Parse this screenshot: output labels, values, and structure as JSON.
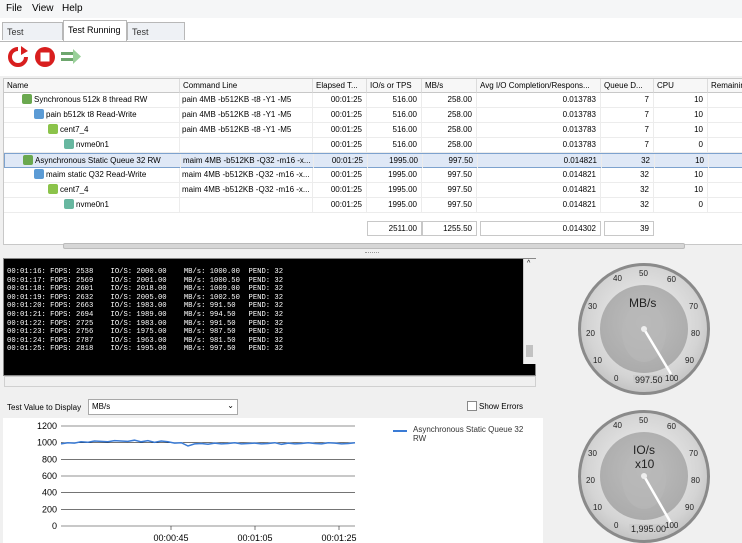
{
  "menu": {
    "file": "File",
    "view": "View",
    "help": "Help"
  },
  "tabs": [
    {
      "label": "Test Planning"
    },
    {
      "label": "Test Running"
    },
    {
      "label": "Test Analysis"
    }
  ],
  "grid": {
    "headers": [
      "Name",
      "Command Line",
      "Elapsed T...",
      "IO/s or TPS",
      "MB/s",
      "Avg I/O Completion/Respons...",
      "Queue D...",
      "CPU",
      "Remainin"
    ],
    "rows": [
      {
        "name": "Synchronous 512k 8 thread RW",
        "cmd": "pain 4MB -b512KB -t8 -Y1 -M5",
        "elapsed": "00:01:25",
        "io": "516.00",
        "mbs": "258.00",
        "avg": "0.013783",
        "queue": "7",
        "cpu": "10"
      },
      {
        "name": "pain b512k t8 Read-Write",
        "cmd": "pain 4MB -b512KB -t8 -Y1 -M5",
        "elapsed": "00:01:25",
        "io": "516.00",
        "mbs": "258.00",
        "avg": "0.013783",
        "queue": "7",
        "cpu": "10"
      },
      {
        "name": "cent7_4",
        "cmd": "pain 4MB -b512KB -t8 -Y1 -M5",
        "elapsed": "00:01:25",
        "io": "516.00",
        "mbs": "258.00",
        "avg": "0.013783",
        "queue": "7",
        "cpu": "10"
      },
      {
        "name": "nvme0n1",
        "cmd": "",
        "elapsed": "00:01:25",
        "io": "516.00",
        "mbs": "258.00",
        "avg": "0.013783",
        "queue": "7",
        "cpu": "0"
      },
      {
        "name": "Asynchronous Static Queue 32 RW",
        "cmd": "maim 4MB -b512KB -Q32 -m16 -x...",
        "elapsed": "00:01:25",
        "io": "1995.00",
        "mbs": "997.50",
        "avg": "0.014821",
        "queue": "32",
        "cpu": "10"
      },
      {
        "name": "maim static Q32 Read-Write",
        "cmd": "maim 4MB -b512KB -Q32 -m16 -x...",
        "elapsed": "00:01:25",
        "io": "1995.00",
        "mbs": "997.50",
        "avg": "0.014821",
        "queue": "32",
        "cpu": "10"
      },
      {
        "name": "cent7_4",
        "cmd": "maim 4MB -b512KB -Q32 -m16 -x...",
        "elapsed": "00:01:25",
        "io": "1995.00",
        "mbs": "997.50",
        "avg": "0.014821",
        "queue": "32",
        "cpu": "10"
      },
      {
        "name": "nvme0n1",
        "cmd": "",
        "elapsed": "00:01:25",
        "io": "1995.00",
        "mbs": "997.50",
        "avg": "0.014821",
        "queue": "32",
        "cpu": "0"
      }
    ],
    "totals": {
      "io": "2511.00",
      "mbs": "1255.50",
      "avg": "0.014302",
      "queue": "39"
    }
  },
  "console_lines": [
    "00:01:16: FOPS: 2538    IO/S: 2000.00    MB/s: 1000.00  PEND: 32",
    "00:01:17: FOPS: 2569    IO/S: 2001.00    MB/s: 1000.50  PEND: 32",
    "00:01:18: FOPS: 2601    IO/S: 2018.00    MB/s: 1009.00  PEND: 32",
    "00:01:19: FOPS: 2632    IO/S: 2005.00    MB/s: 1002.50  PEND: 32",
    "00:01:20: FOPS: 2663    IO/S: 1983.00    MB/s: 991.50   PEND: 32",
    "00:01:21: FOPS: 2694    IO/S: 1989.00    MB/s: 994.50   PEND: 32",
    "00:01:22: FOPS: 2725    IO/S: 1983.00    MB/s: 991.50   PEND: 32",
    "00:01:23: FOPS: 2756    IO/S: 1975.00    MB/s: 987.50   PEND: 32",
    "00:01:24: FOPS: 2787    IO/S: 1963.00    MB/s: 981.50   PEND: 32",
    "00:01:25: FOPS: 2818    IO/S: 1995.00    MB/s: 997.50   PEND: 32"
  ],
  "controls": {
    "display_label": "Test Value to Display",
    "display_value": "MB/s",
    "show_errors": "Show Errors"
  },
  "chart_data": {
    "type": "line",
    "yticks": [
      "1200",
      "1000",
      "800",
      "600",
      "400",
      "200",
      "0"
    ],
    "xticks": [
      "00:00:45",
      "00:01:05",
      "00:01:25"
    ],
    "ylim": [
      0,
      1200
    ],
    "series": [
      {
        "name": "Asynchronous Static Queue 32 RW",
        "color": "#3a7bd5",
        "values": [
          985,
          1000,
          995,
          1010,
          1005,
          1020,
          1015,
          1010,
          1025,
          1020,
          1015,
          1030,
          1010,
          1025,
          1005,
          1020,
          1010,
          995,
          1000,
          960,
          985,
          990,
          980,
          995,
          985,
          990,
          1000,
          985,
          990,
          995,
          985,
          990,
          1000,
          980,
          995,
          985,
          990,
          1000,
          990,
          985,
          1000,
          995,
          985,
          990,
          998
        ]
      }
    ]
  },
  "gauges": [
    {
      "title": "MB/s",
      "value": "997.50",
      "ticks": [
        "0",
        "10",
        "20",
        "30",
        "40",
        "50",
        "60",
        "70",
        "80",
        "90",
        "100"
      ]
    },
    {
      "title": "IO/s",
      "sub": "x10",
      "value": "1,995.00",
      "ticks": [
        "0",
        "10",
        "20",
        "30",
        "40",
        "50",
        "60",
        "70",
        "80",
        "90",
        "100"
      ]
    }
  ]
}
